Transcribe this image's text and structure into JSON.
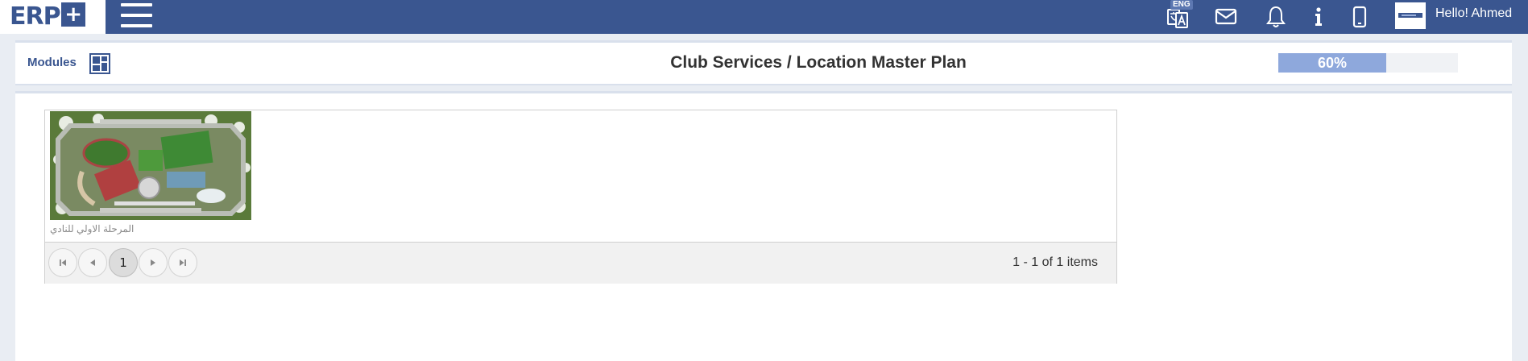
{
  "app": {
    "logo_text": "ERP",
    "logo_plus": "+",
    "language_badge": "ENG",
    "greeting": "Hello! Ahmed"
  },
  "icons": {
    "menu": "hamburger-menu-icon",
    "language": "translate-icon",
    "mail": "envelope-icon",
    "notifications": "bell-icon",
    "info": "info-icon",
    "mobile": "mobile-phone-icon",
    "modules": "modules-grid-icon"
  },
  "header": {
    "modules_label": "Modules",
    "title": "Club Services / Location Master Plan",
    "progress_value": 60,
    "progress_label": "60%"
  },
  "gallery": {
    "items": [
      {
        "caption": "المرحلة الاولي للنادي"
      }
    ],
    "pager": {
      "current_page": "1",
      "info": "1 - 1 of 1 items"
    }
  },
  "colors": {
    "brand": "#3a5690",
    "progress_fill": "#8ea8dc",
    "background": "#e9edf3"
  }
}
